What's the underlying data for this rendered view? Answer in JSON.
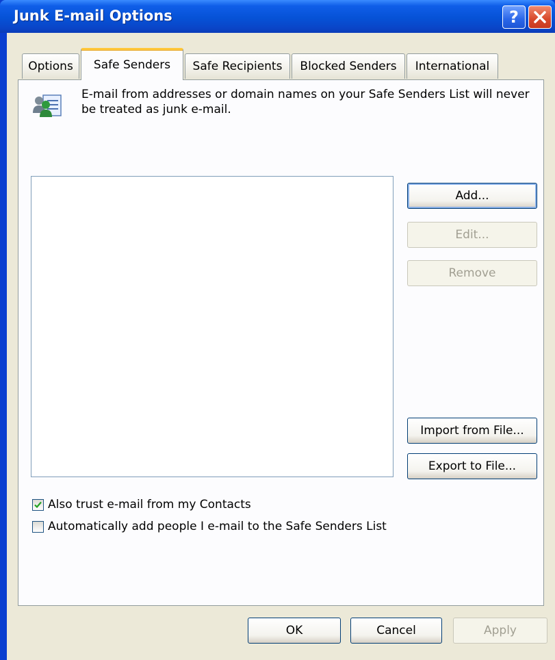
{
  "window": {
    "title": "Junk E-mail Options",
    "help_glyph": "?"
  },
  "tabs": [
    {
      "label": "Options"
    },
    {
      "label": "Safe Senders"
    },
    {
      "label": "Safe Recipients"
    },
    {
      "label": "Blocked Senders"
    },
    {
      "label": "International"
    }
  ],
  "active_tab": "Safe Senders",
  "safe_senders": {
    "description": "E-mail from addresses or domain names on your Safe Senders List will never be treated as junk e-mail.",
    "icon": "contacts-list-icon",
    "list_items": [],
    "buttons": {
      "add": "Add...",
      "edit": "Edit...",
      "remove": "Remove",
      "import": "Import from File...",
      "export": "Export to File..."
    },
    "checkboxes": [
      {
        "label": "Also trust e-mail from my Contacts",
        "checked": true
      },
      {
        "label": "Automatically add people I e-mail to the Safe Senders List",
        "checked": false
      }
    ]
  },
  "footer": {
    "ok": "OK",
    "cancel": "Cancel",
    "apply": "Apply"
  },
  "colors": {
    "titlebar": "#0652D6",
    "dialog_face": "#ECE9D8",
    "tab_highlight": "#FFC83C"
  }
}
